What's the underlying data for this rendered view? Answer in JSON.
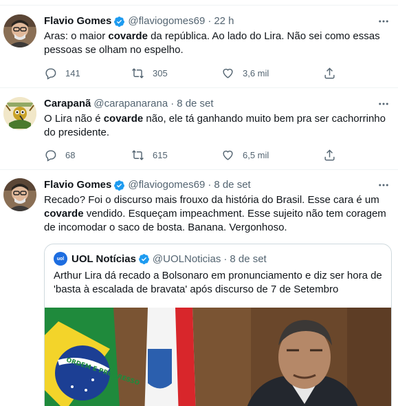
{
  "tweets": [
    {
      "name": "Flavio Gomes",
      "verified": true,
      "handle": "@flaviogomes69",
      "time": "22 h",
      "text_pre": "Aras: o maior ",
      "text_bold": "covarde",
      "text_post": " da república. Ao lado do Lira. Não sei como essas pessoas se olham no espelho.",
      "replies": "141",
      "retweets": "305",
      "likes": "3,6 mil"
    },
    {
      "name": "Carapanã",
      "verified": false,
      "handle": "@carapanarana",
      "time": "8 de set",
      "text_pre": "O Lira não é ",
      "text_bold": "covarde",
      "text_post": " não, ele tá ganhando muito bem pra ser cachorrinho do presidente.",
      "replies": "68",
      "retweets": "615",
      "likes": "6,5 mil"
    },
    {
      "name": "Flavio Gomes",
      "verified": true,
      "handle": "@flaviogomes69",
      "time": "8 de set",
      "text_pre": "Recado? Foi o discurso mais frouxo da história do Brasil. Esse cara é um ",
      "text_bold": "covarde",
      "text_post": " vendido. Esqueçam impeachment. Esse sujeito não tem coragem de incomodar o saco de bosta. Banana. Vergonhoso.",
      "quote": {
        "logo": "uol",
        "name": "UOL Notícias",
        "verified": true,
        "handle": "@UOLNoticias",
        "time": "8 de set",
        "text": "Arthur Lira dá recado a Bolsonaro em pronunciamento e diz ser hora de 'basta à escalada de bravata' após discurso de 7 de Setembro",
        "image_flag_text": "ORDEM E PROGRESSO"
      }
    }
  ],
  "separator": "·",
  "icons": {
    "reply": "reply-icon",
    "retweet": "retweet-icon",
    "like": "heart-icon",
    "share": "share-icon",
    "more": "more-icon",
    "verified": "verified-badge-icon"
  },
  "colors": {
    "text": "#0f1419",
    "secondary": "#536471",
    "verified": "#1d9bf0",
    "border": "#eff3f4"
  }
}
